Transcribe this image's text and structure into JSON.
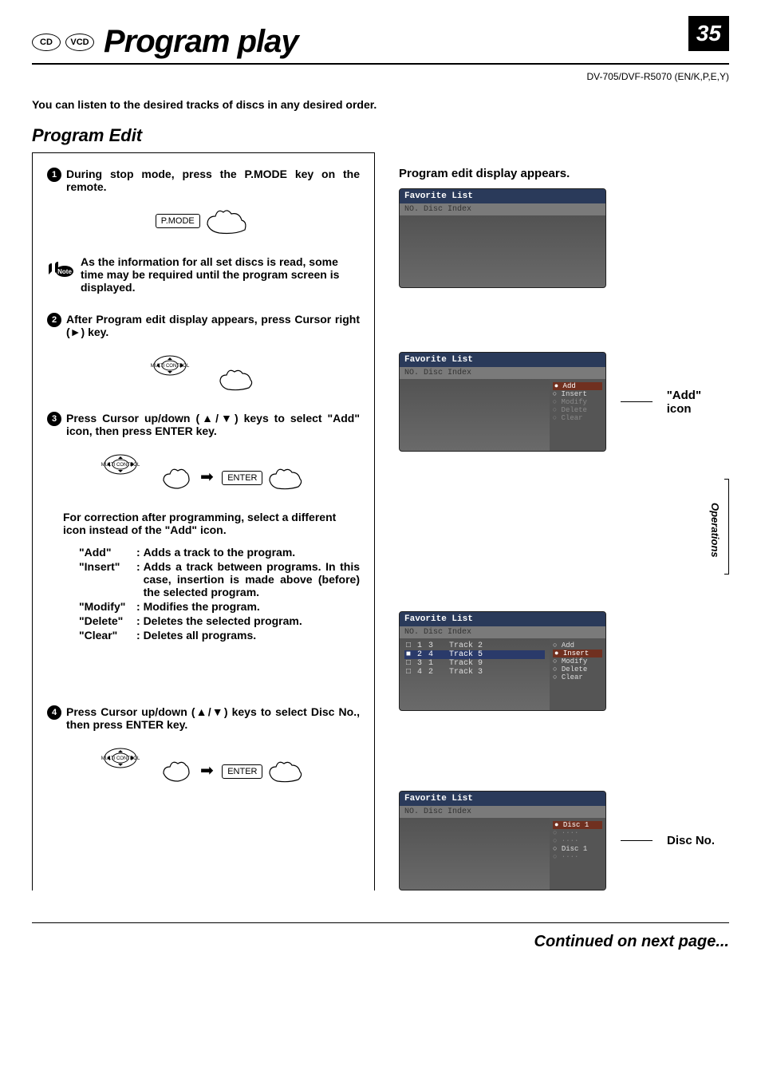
{
  "page_number": "35",
  "disc_badges": [
    "CD",
    "VCD"
  ],
  "page_title": "Program play",
  "model_line": "DV-705/DVF-R5070 (EN/K,P,E,Y)",
  "intro": "You can listen to the desired tracks of discs  in any desired order.",
  "section_heading": "Program Edit",
  "side_tab": "Operations",
  "steps": {
    "s1": "During stop mode, press the P.MODE key on the remote.",
    "s2": "After Program edit display appears, press Cursor right (►) key.",
    "s3": "Press Cursor up/down (▲/▼) keys to select \"Add\" icon, then press ENTER key.",
    "s4": "Press Cursor up/down (▲/▼) keys to select Disc No., then press ENTER key."
  },
  "pmode_label": "P.MODE",
  "enter_label": "ENTER",
  "multi_control_label": "MULTI CONTROL",
  "note_text": "As the information for all set discs is read, some time may be required until the program screen is displayed.",
  "note_badge": "Note",
  "correction_text": "For correction after programming, select a different icon instead of the \"Add\" icon.",
  "definitions": [
    {
      "term": "\"Add\"",
      "desc": "Adds a track to the program."
    },
    {
      "term": "\"Insert\"",
      "desc": "Adds a track between programs. In this case, insertion is made above (before) the selected program."
    },
    {
      "term": "\"Modify\"",
      "desc": "Modifies the program."
    },
    {
      "term": "\"Delete\"",
      "desc": "Deletes the selected program."
    },
    {
      "term": "\"Clear\"",
      "desc": "Deletes all programs."
    }
  ],
  "right": {
    "heading1": "Program edit display appears.",
    "osd_title": "Favorite List",
    "osd_columns": "NO.   Disc   Index",
    "menu_items": [
      "Add",
      "Insert",
      "Modify",
      "Delete",
      "Clear"
    ],
    "callout_add": "\"Add\" icon",
    "callout_disc": "Disc No.",
    "disc_menu_label": "Disc 1",
    "program_rows": [
      {
        "no": "1",
        "disc": "3",
        "track": "Track  2"
      },
      {
        "no": "2",
        "disc": "4",
        "track": "Track  5"
      },
      {
        "no": "3",
        "disc": "1",
        "track": "Track  9"
      },
      {
        "no": "4",
        "disc": "2",
        "track": "Track  3"
      }
    ]
  },
  "continued": "Continued on next page..."
}
